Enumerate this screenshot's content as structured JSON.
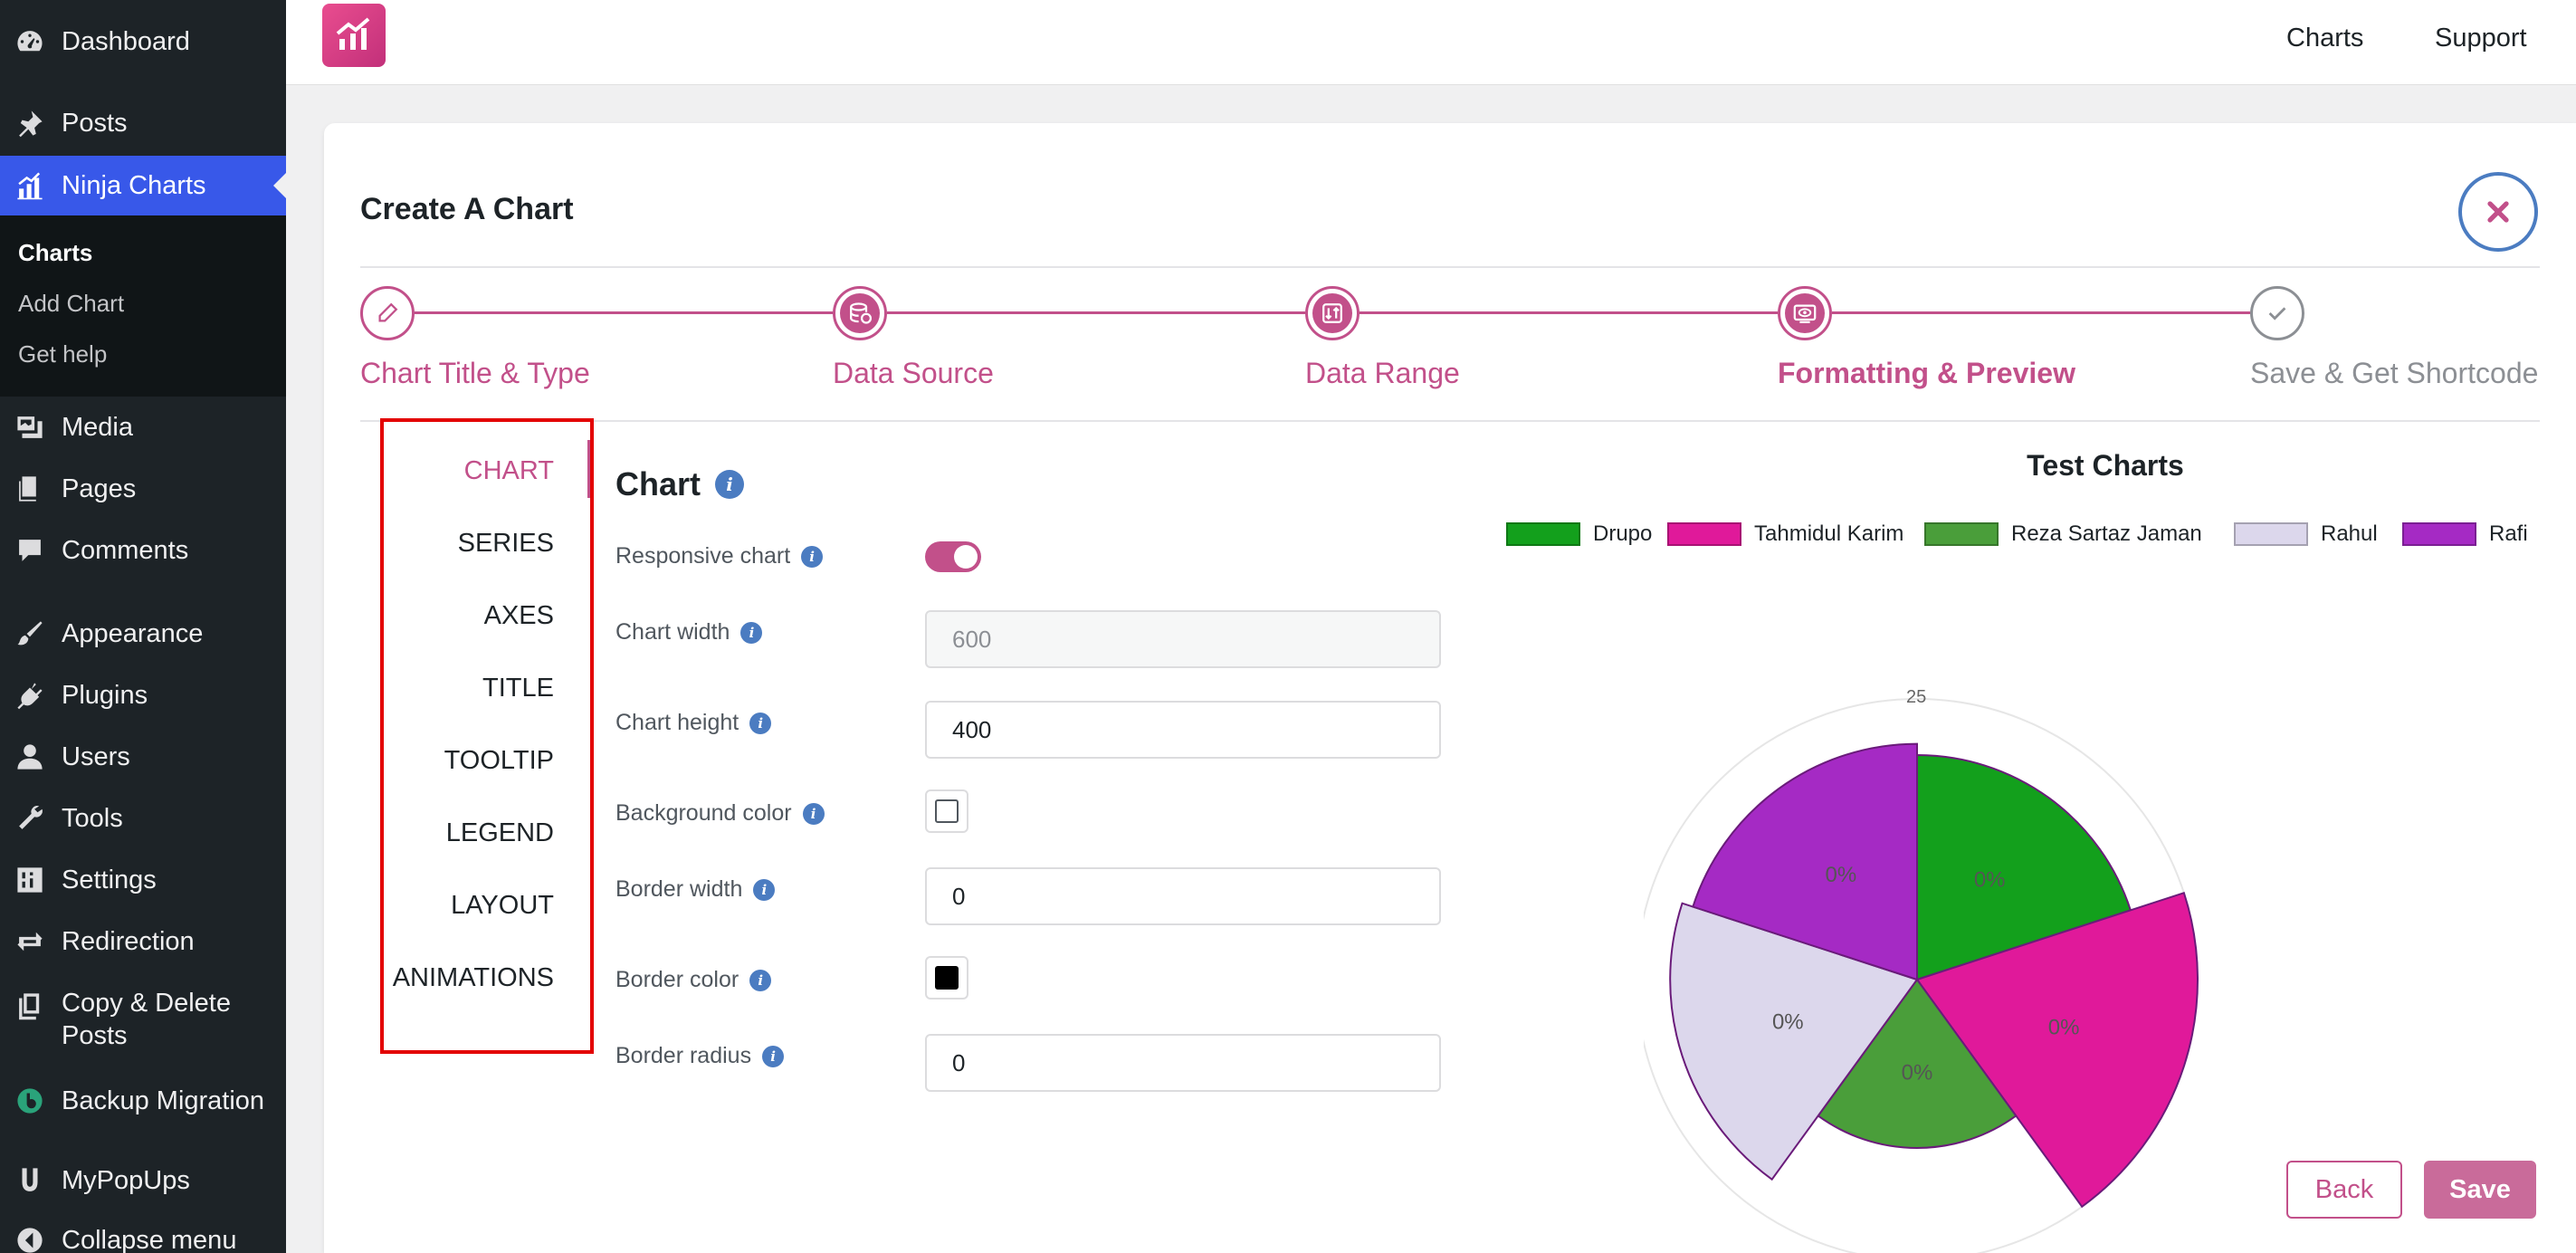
{
  "sidebar": {
    "items": [
      {
        "label": "Dashboard",
        "icon": "dashboard-icon"
      },
      {
        "label": "Posts",
        "icon": "pin-icon"
      },
      {
        "label": "Ninja Charts",
        "icon": "chart-icon"
      },
      {
        "label": "Media",
        "icon": "media-icon"
      },
      {
        "label": "Pages",
        "icon": "pages-icon"
      },
      {
        "label": "Comments",
        "icon": "comment-icon"
      },
      {
        "label": "Appearance",
        "icon": "brush-icon"
      },
      {
        "label": "Plugins",
        "icon": "plug-icon"
      },
      {
        "label": "Users",
        "icon": "user-icon"
      },
      {
        "label": "Tools",
        "icon": "wrench-icon"
      },
      {
        "label": "Settings",
        "icon": "sliders-icon"
      },
      {
        "label": "Redirection",
        "icon": "arrows-icon"
      },
      {
        "label": "Copy & Delete Posts",
        "icon": "copy-icon"
      },
      {
        "label": "Backup Migration",
        "icon": "backup-icon"
      },
      {
        "label": "MyPopUps",
        "icon": "popup-icon"
      },
      {
        "label": "Collapse menu",
        "icon": "collapse-icon"
      }
    ],
    "submenu": [
      "Charts",
      "Add Chart",
      "Get help"
    ]
  },
  "topbar": {
    "links": [
      "Charts",
      "Support"
    ]
  },
  "card": {
    "title": "Create A Chart"
  },
  "steps": [
    {
      "label": "Chart Title & Type",
      "icon": "pencil-icon"
    },
    {
      "label": "Data Source",
      "icon": "database-icon"
    },
    {
      "label": "Data Range",
      "icon": "range-icon"
    },
    {
      "label": "Formatting & Preview",
      "icon": "preview-icon"
    },
    {
      "label": "Save & Get Shortcode",
      "icon": "check-icon"
    }
  ],
  "tabs": [
    "CHART",
    "SERIES",
    "AXES",
    "TITLE",
    "TOOLTIP",
    "LEGEND",
    "LAYOUT",
    "ANIMATIONS"
  ],
  "form": {
    "title": "Chart",
    "responsive_label": "Responsive chart",
    "width_label": "Chart width",
    "width_placeholder": "600",
    "height_label": "Chart height",
    "height_value": "400",
    "bg_label": "Background color",
    "border_width_label": "Border width",
    "border_width_value": "0",
    "border_color_label": "Border color",
    "border_radius_label": "Border radius",
    "border_radius_value": "0"
  },
  "chart_data": {
    "type": "pie",
    "title": "Test Charts",
    "scale_tick": "25",
    "legend_placement": "top",
    "series": [
      {
        "name": "Drupo",
        "color": "#13a01c",
        "label": "0%",
        "value": 20
      },
      {
        "name": "Tahmidul Karim",
        "color": "#e0199a",
        "label": "0%",
        "value": 25
      },
      {
        "name": "Reza Sartaz Jaman",
        "color": "#4a9e3a",
        "label": "0%",
        "value": 15
      },
      {
        "name": "Rahul",
        "color": "#dcd7ec",
        "label": "0%",
        "value": 22
      },
      {
        "name": "Rafi",
        "color": "#a52ac4",
        "label": "0%",
        "value": 21
      }
    ]
  },
  "actions": {
    "back": "Back",
    "save": "Save"
  },
  "colors": {
    "brand": "#c2508a",
    "sidebar_bg": "#1d2327",
    "active_menu": "#3858e9",
    "highlight_border": "#e30000"
  }
}
